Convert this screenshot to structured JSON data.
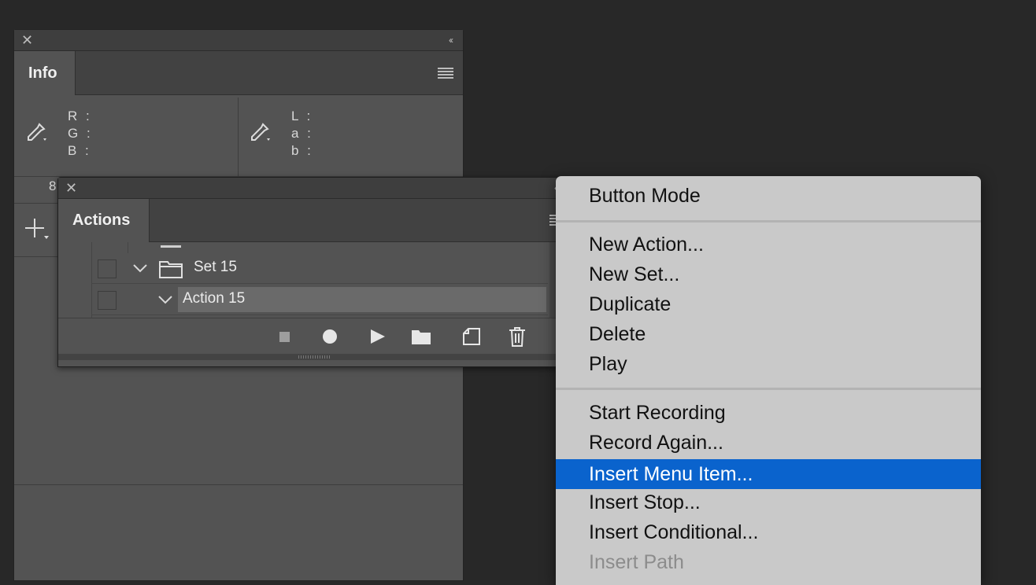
{
  "info_panel": {
    "tab": "Info",
    "left_readout": [
      "R :",
      "G :",
      "B :"
    ],
    "right_readout": [
      "L :",
      "a :",
      "b :"
    ],
    "partial_label": "8"
  },
  "actions_panel": {
    "tab": "Actions",
    "rows": [
      {
        "label": "Set 15",
        "type": "set"
      },
      {
        "label": "Action 15",
        "type": "action",
        "selected": true
      }
    ]
  },
  "context_menu": {
    "items": [
      {
        "label": "Button Mode"
      },
      {
        "label": "New Action..."
      },
      {
        "label": "New Set..."
      },
      {
        "label": "Duplicate"
      },
      {
        "label": "Delete"
      },
      {
        "label": "Play"
      },
      {
        "label": "Start Recording"
      },
      {
        "label": "Record Again..."
      },
      {
        "label": "Insert Menu Item...",
        "highlighted": true
      },
      {
        "label": "Insert Stop..."
      },
      {
        "label": "Insert Conditional..."
      },
      {
        "label": "Insert Path",
        "disabled": true
      }
    ]
  },
  "colors": {
    "background": "#282828",
    "panel": "#535353",
    "menu": "#c9c9c9",
    "highlight": "#0a63cd"
  }
}
